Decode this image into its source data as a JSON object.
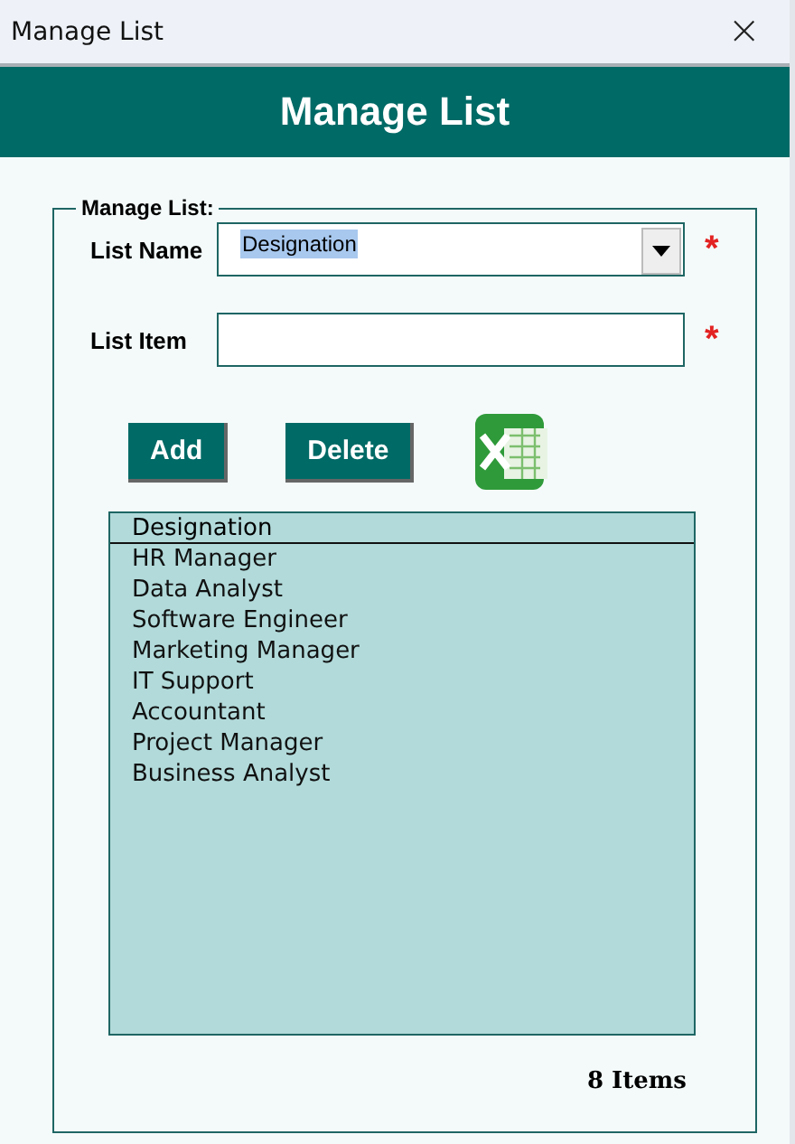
{
  "window": {
    "title": "Manage List",
    "close": "×"
  },
  "header": "Manage List",
  "group": {
    "legend": "Manage List:",
    "list_name": {
      "label": "List Name",
      "value": "Designation",
      "value_selected": true,
      "required": "*"
    },
    "list_item": {
      "label": "List Item",
      "required": "*"
    },
    "buttons": [
      "Add",
      "Delete"
    ],
    "listbox": {
      "column": "Designation",
      "items": [
        {
          "text": "HR Manager",
          "selected": false
        },
        {
          "text": "Data Analyst",
          "selected": false
        },
        {
          "text": "Software Engineer",
          "selected": false
        },
        {
          "text": "Marketing Manager",
          "selected": false
        },
        {
          "text": "IT Support",
          "selected": false
        },
        {
          "text": "Accountant",
          "selected": false
        },
        {
          "text": "Project Manager",
          "selected": false
        },
        {
          "text": "Business Analyst",
          "selected": false
        }
      ]
    },
    "count": "8 Items"
  }
}
